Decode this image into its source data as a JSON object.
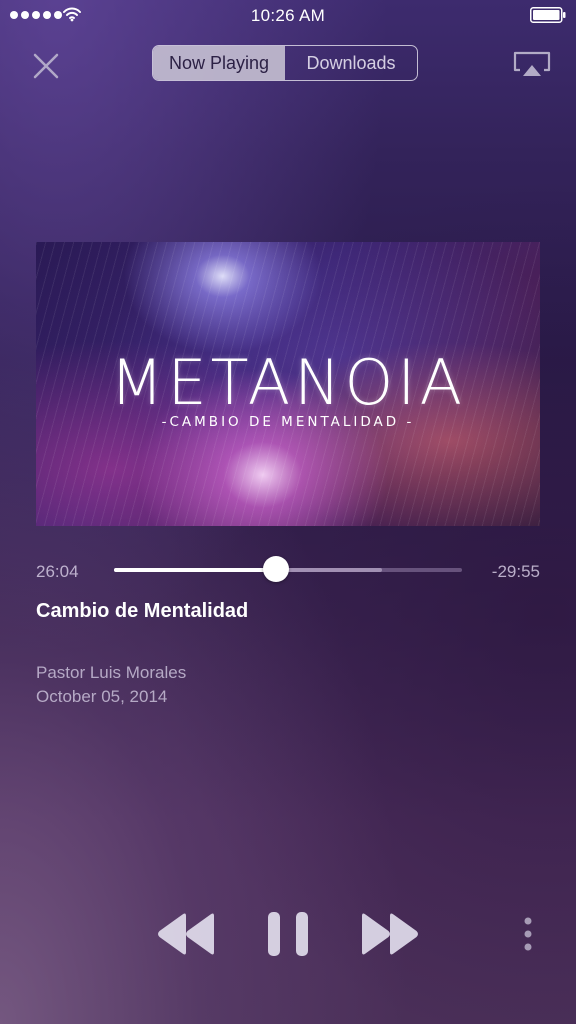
{
  "status_bar": {
    "time": "10:26 AM",
    "signal_icon": "signal-dots-icon",
    "wifi_icon": "wifi-icon",
    "battery_icon": "battery-icon"
  },
  "nav": {
    "close_icon": "close-icon",
    "tabs": [
      {
        "label": "Now Playing",
        "active": true
      },
      {
        "label": "Downloads",
        "active": false
      }
    ],
    "airplay_icon": "airplay-icon"
  },
  "artwork": {
    "title": "METANOIA",
    "subtitle": "-CAMBIO DE MENTALIDAD -"
  },
  "player": {
    "elapsed": "26:04",
    "remaining": "-29:55",
    "progress_fraction": 0.466,
    "buffered_fraction": 0.77
  },
  "info": {
    "title": "Cambio de Mentalidad",
    "speaker": "Pastor Luis Morales",
    "date": "October 05, 2014"
  },
  "controls": {
    "rewind_icon": "rewind-icon",
    "pause_icon": "pause-icon",
    "forward_icon": "fast-forward-icon",
    "more_icon": "more-vertical-icon"
  },
  "colors": {
    "accent": "#ffffff",
    "background_top": "#3d2b6e",
    "background_bottom": "#4a2f58"
  }
}
